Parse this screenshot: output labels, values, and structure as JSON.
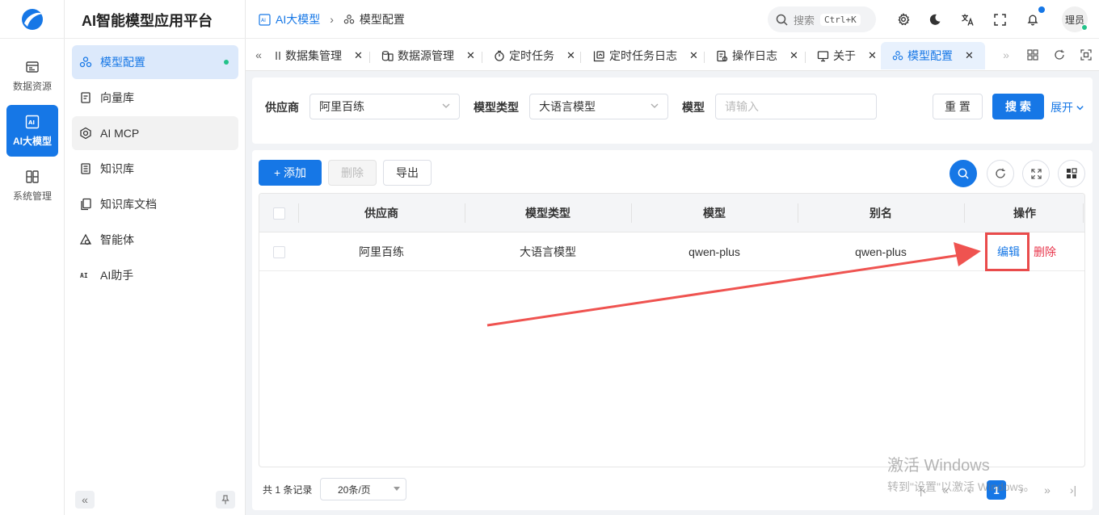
{
  "app": {
    "title": "AI智能模型应用平台"
  },
  "rail": {
    "items": [
      {
        "label": "数据资源",
        "icon": "database-icon"
      },
      {
        "label": "AI大模型",
        "icon": "ai-icon"
      },
      {
        "label": "系统管理",
        "icon": "system-icon"
      }
    ]
  },
  "sidebar": {
    "items": [
      {
        "label": "模型配置",
        "icon": "model-icon"
      },
      {
        "label": "向量库",
        "icon": "vector-icon"
      },
      {
        "label": "AI MCP",
        "icon": "mcp-icon"
      },
      {
        "label": "知识库",
        "icon": "book-icon"
      },
      {
        "label": "知识库文档",
        "icon": "docs-icon"
      },
      {
        "label": "智能体",
        "icon": "agent-icon"
      },
      {
        "label": "AI助手",
        "icon": "ai-assistant-icon"
      }
    ]
  },
  "breadcrumb": {
    "parent": "AI大模型",
    "current": "模型配置"
  },
  "header": {
    "search_label": "搜索",
    "shortcut": "Ctrl+K",
    "user": "理员"
  },
  "tabs": [
    {
      "label": "数据集管理"
    },
    {
      "label": "数据源管理"
    },
    {
      "label": "定时任务"
    },
    {
      "label": "定时任务日志"
    },
    {
      "label": "操作日志"
    },
    {
      "label": "关于"
    },
    {
      "label": "模型配置"
    }
  ],
  "filter": {
    "provider_label": "供应商",
    "provider_value": "阿里百练",
    "type_label": "模型类型",
    "type_value": "大语言模型",
    "model_label": "模型",
    "model_placeholder": "请输入",
    "reset": "重 置",
    "search": "搜 索",
    "expand": "展开"
  },
  "toolbar": {
    "add": "+ 添加",
    "delete": "删除",
    "export": "导出"
  },
  "table": {
    "columns": [
      "供应商",
      "模型类型",
      "模型",
      "别名",
      "操作"
    ],
    "rows": [
      {
        "provider": "阿里百练",
        "type": "大语言模型",
        "model": "qwen-plus",
        "alias": "qwen-plus",
        "edit": "编辑",
        "delete": "删除"
      }
    ]
  },
  "pagination": {
    "total": "共 1 条记录",
    "page_size": "20条/页",
    "current": "1"
  },
  "watermark": {
    "line1": "激活 Windows",
    "line2": "转到\"设置\"以激活 Windows。"
  },
  "colors": {
    "primary": "#1677e6",
    "danger": "#e8344a",
    "annotation": "#e94b4b",
    "online": "#23c289"
  }
}
